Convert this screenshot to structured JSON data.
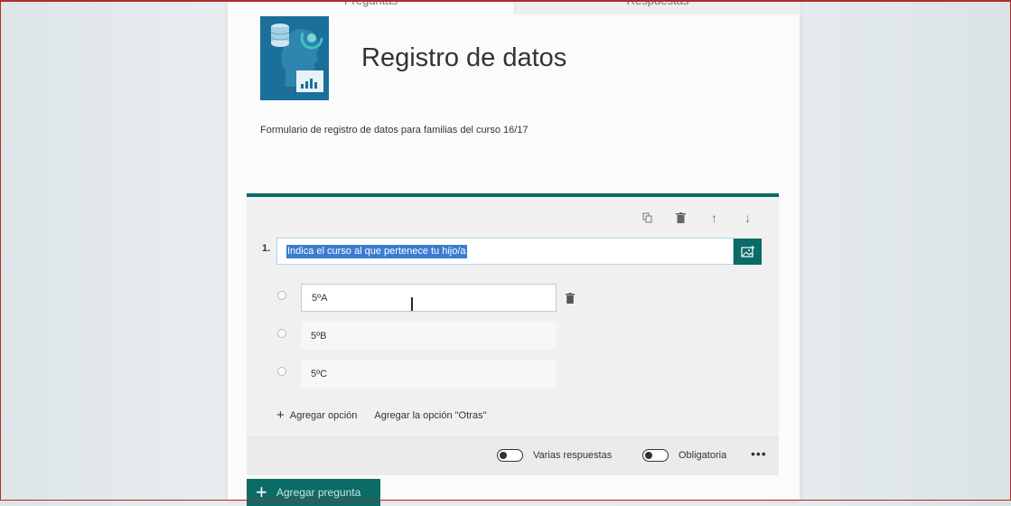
{
  "tabs": {
    "questions": "Preguntas",
    "responses": "Respuestas"
  },
  "form": {
    "title": "Registro de datos",
    "description": "Formulario de registro de datos para familias del curso 16/17"
  },
  "question": {
    "number": "1.",
    "text": "Indica el curso al que pertenece tu hijo/a",
    "options": [
      "5ºA",
      "5ºB",
      "5ºC"
    ],
    "add_option": "Agregar opción",
    "add_other": "Agregar la opción \"Otras\"",
    "multiple_answers": "Varias respuestas",
    "required": "Obligatoria",
    "more": "•••"
  },
  "add_question": "Agregar pregunta",
  "colors": {
    "accent": "#0b6b66",
    "logo": "#1b6f9b"
  }
}
